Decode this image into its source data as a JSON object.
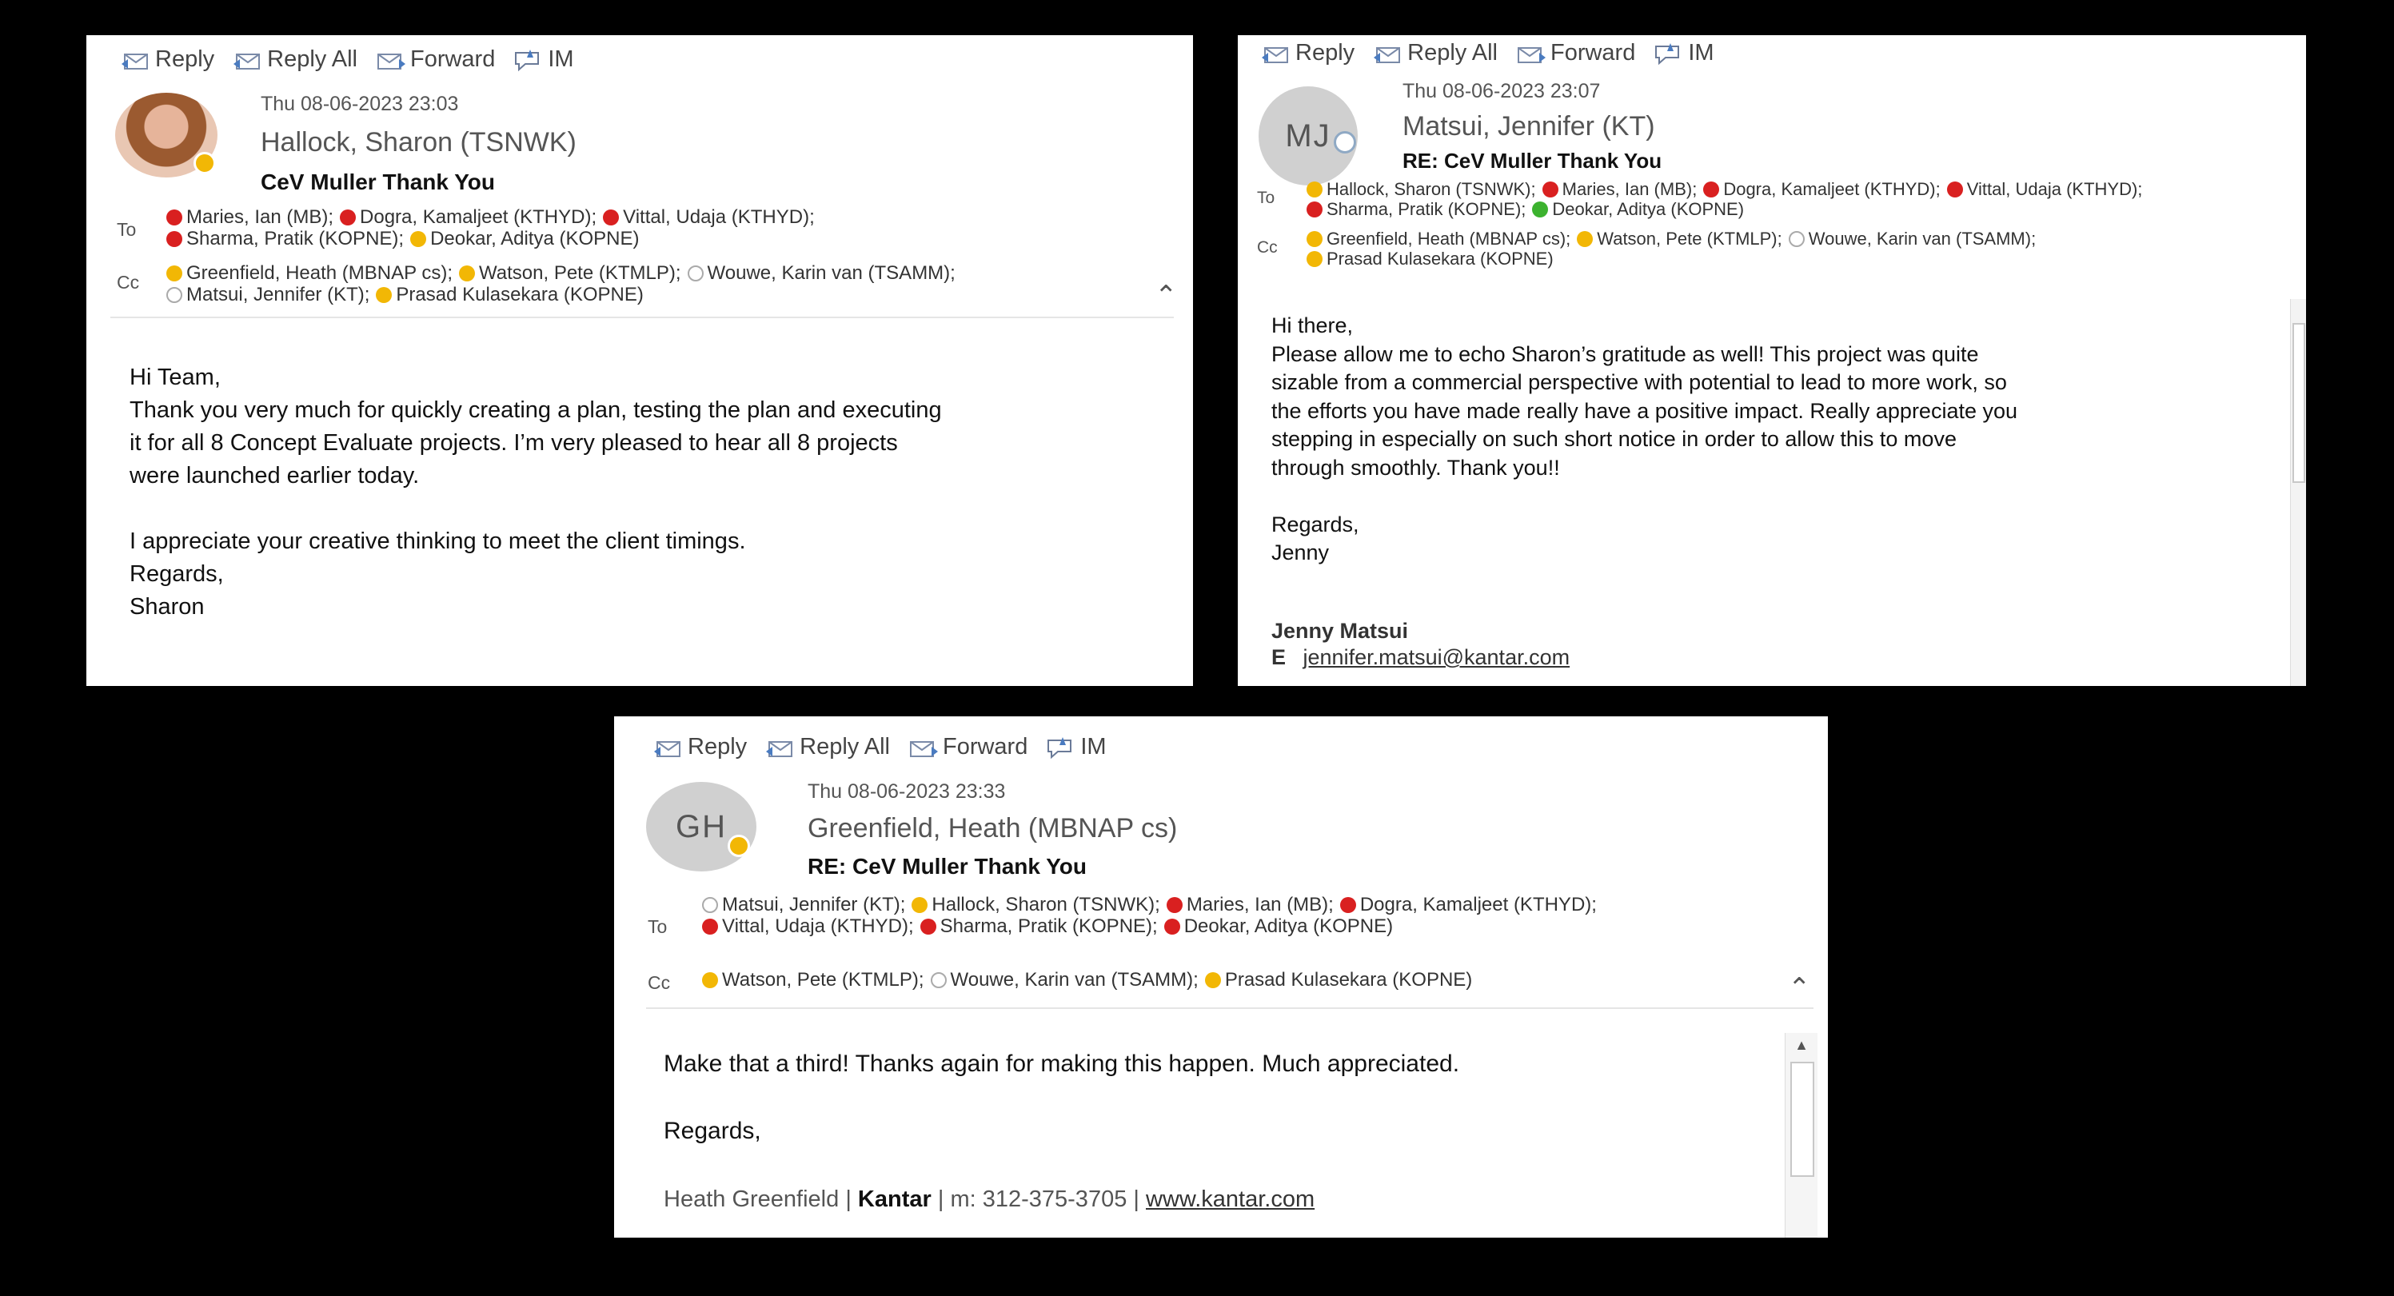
{
  "toolbar": {
    "reply": "Reply",
    "reply_all": "Reply All",
    "forward": "Forward",
    "im": "IM"
  },
  "labels": {
    "to": "To",
    "cc": "Cc"
  },
  "email1": {
    "date": "Thu 08-06-2023 23:03",
    "sender": "Hallock, Sharon (TSNWK)",
    "subject": "CeV Muller Thank You",
    "to": [
      {
        "name": "Maries, Ian (MB);",
        "status": "busy"
      },
      {
        "name": "Dogra, Kamaljeet (KTHYD);",
        "status": "busy"
      },
      {
        "name": "Vittal, Udaja (KTHYD);",
        "status": "busy"
      },
      {
        "name": "Sharma, Pratik (KOPNE);",
        "status": "busy"
      },
      {
        "name": "Deokar, Aditya (KOPNE)",
        "status": "away"
      }
    ],
    "cc": [
      {
        "name": "Greenfield, Heath (MBNAP cs);",
        "status": "away"
      },
      {
        "name": "Watson, Pete (KTMLP);",
        "status": "away"
      },
      {
        "name": "Wouwe, Karin van (TSAMM);",
        "status": "off"
      },
      {
        "name": "Matsui, Jennifer (KT);",
        "status": "off"
      },
      {
        "name": "Prasad Kulasekara (KOPNE)",
        "status": "away"
      }
    ],
    "body": [
      "Hi Team,",
      "Thank you very much for quickly creating a plan, testing the plan and executing",
      "it for all 8 Concept Evaluate projects. I’m very pleased to hear all 8 projects",
      "were launched earlier today.",
      "",
      "I appreciate your creative thinking to meet the client timings.",
      "Regards,",
      "Sharon"
    ]
  },
  "email2": {
    "initials": "MJ",
    "date": "Thu 08-06-2023 23:07",
    "sender": "Matsui, Jennifer (KT)",
    "subject": "RE: CeV Muller Thank You",
    "to": [
      {
        "name": "Hallock, Sharon (TSNWK);",
        "status": "away"
      },
      {
        "name": "Maries, Ian (MB);",
        "status": "busy"
      },
      {
        "name": "Dogra, Kamaljeet (KTHYD);",
        "status": "busy"
      },
      {
        "name": "Vittal, Udaja (KTHYD);",
        "status": "busy"
      },
      {
        "name": "Sharma, Pratik (KOPNE);",
        "status": "busy"
      },
      {
        "name": "Deokar, Aditya (KOPNE)",
        "status": "avail"
      }
    ],
    "cc": [
      {
        "name": "Greenfield, Heath (MBNAP cs);",
        "status": "away"
      },
      {
        "name": "Watson, Pete (KTMLP);",
        "status": "away"
      },
      {
        "name": "Wouwe, Karin van (TSAMM);",
        "status": "off"
      },
      {
        "name": "Prasad Kulasekara (KOPNE)",
        "status": "away"
      }
    ],
    "body": [
      "Hi there,",
      "Please allow me to echo Sharon’s gratitude as well! This project was quite",
      "sizable from a commercial perspective with potential to lead to more work, so",
      "the efforts you have made really have a positive impact. Really appreciate you",
      "stepping in especially on such short notice in order to allow this to move",
      "through smoothly. Thank you!!",
      "",
      "Regards,",
      "Jenny"
    ],
    "sig_name": "Jenny Matsui",
    "sig_e": "E",
    "sig_email": "jennifer.matsui@kantar.com"
  },
  "email3": {
    "initials": "GH",
    "date": "Thu 08-06-2023 23:33",
    "sender": "Greenfield, Heath (MBNAP cs)",
    "subject": "RE: CeV Muller Thank You",
    "to": [
      {
        "name": "Matsui, Jennifer (KT);",
        "status": "off"
      },
      {
        "name": "Hallock, Sharon (TSNWK);",
        "status": "away"
      },
      {
        "name": "Maries, Ian (MB);",
        "status": "busy"
      },
      {
        "name": "Dogra, Kamaljeet (KTHYD);",
        "status": "busy"
      },
      {
        "name": "Vittal, Udaja (KTHYD);",
        "status": "busy"
      },
      {
        "name": "Sharma, Pratik (KOPNE);",
        "status": "busy"
      },
      {
        "name": "Deokar, Aditya (KOPNE)",
        "status": "busy"
      }
    ],
    "cc": [
      {
        "name": "Watson, Pete (KTMLP);",
        "status": "away"
      },
      {
        "name": "Wouwe, Karin van (TSAMM);",
        "status": "off"
      },
      {
        "name": "Prasad Kulasekara (KOPNE)",
        "status": "away"
      }
    ],
    "body": [
      "Make that a third! Thanks again for making this happen. Much appreciated.",
      "",
      "Regards,"
    ],
    "sig_name": "Heath Greenfield",
    "sig_sep1": "|",
    "sig_company": "Kantar",
    "sig_sep2": "|",
    "sig_phone": "m: 312-375-3705",
    "sig_sep3": "|",
    "sig_web": "www.kantar.com"
  }
}
